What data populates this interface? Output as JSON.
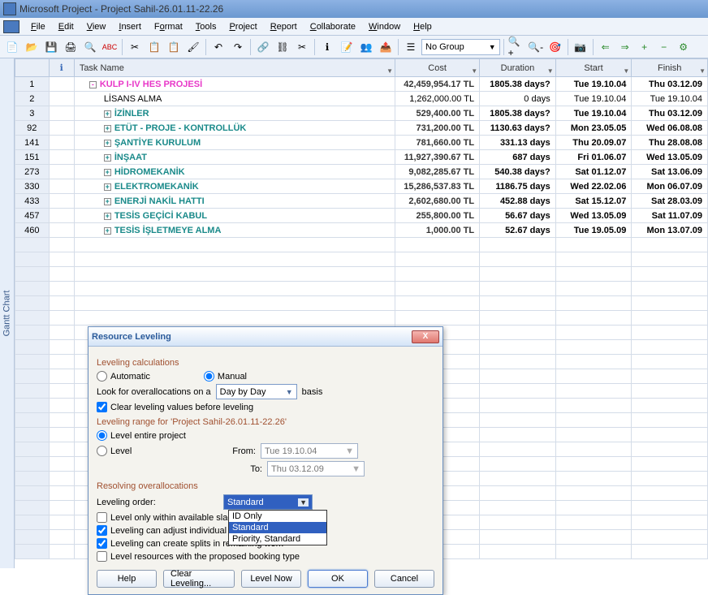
{
  "app_title": "Microsoft Project - Project Sahil-26.01.11-22.26",
  "menu": {
    "file": "File",
    "edit": "Edit",
    "view": "View",
    "insert": "Insert",
    "format": "Format",
    "tools": "Tools",
    "project": "Project",
    "report": "Report",
    "collaborate": "Collaborate",
    "window": "Window",
    "help": "Help"
  },
  "toolbar": {
    "group_label": "No Group"
  },
  "side_label": "Gantt Chart",
  "grid": {
    "headers": {
      "info": "ℹ",
      "task": "Task Name",
      "cost": "Cost",
      "duration": "Duration",
      "start": "Start",
      "finish": "Finish"
    },
    "rows": [
      {
        "n": "1",
        "task": "KULP I-IV HES PROJESİ",
        "cost": "42,459,954.17 TL",
        "dur": "1805.38 days?",
        "start": "Tue 19.10.04",
        "fin": "Thu 03.12.09",
        "cls": "proj",
        "exp": "-",
        "ind": 1
      },
      {
        "n": "2",
        "task": "LİSANS ALMA",
        "cost": "1,262,000.00 TL",
        "dur": "0 days",
        "start": "Tue 19.10.04",
        "fin": "Tue 19.10.04",
        "cls": "",
        "exp": "",
        "ind": 2
      },
      {
        "n": "3",
        "task": "İZİNLER",
        "cost": "529,400.00 TL",
        "dur": "1805.38 days?",
        "start": "Tue 19.10.04",
        "fin": "Thu 03.12.09",
        "cls": "subhead",
        "exp": "+",
        "ind": 2
      },
      {
        "n": "92",
        "task": "ETÜT - PROJE - KONTROLLÜK",
        "cost": "731,200.00 TL",
        "dur": "1130.63 days?",
        "start": "Mon 23.05.05",
        "fin": "Wed 06.08.08",
        "cls": "subhead",
        "exp": "+",
        "ind": 2
      },
      {
        "n": "141",
        "task": "ŞANTİYE KURULUM",
        "cost": "781,660.00 TL",
        "dur": "331.13 days",
        "start": "Thu 20.09.07",
        "fin": "Thu 28.08.08",
        "cls": "subhead",
        "exp": "+",
        "ind": 2
      },
      {
        "n": "151",
        "task": "İNŞAAT",
        "cost": "11,927,390.67 TL",
        "dur": "687 days",
        "start": "Fri 01.06.07",
        "fin": "Wed 13.05.09",
        "cls": "subhead",
        "exp": "+",
        "ind": 2
      },
      {
        "n": "273",
        "task": "HİDROMEKANİK",
        "cost": "9,082,285.67 TL",
        "dur": "540.38 days?",
        "start": "Sat 01.12.07",
        "fin": "Sat 13.06.09",
        "cls": "subhead",
        "exp": "+",
        "ind": 2
      },
      {
        "n": "330",
        "task": "ELEKTROMEKANİK",
        "cost": "15,286,537.83 TL",
        "dur": "1186.75 days",
        "start": "Wed 22.02.06",
        "fin": "Mon 06.07.09",
        "cls": "subhead",
        "exp": "+",
        "ind": 2
      },
      {
        "n": "433",
        "task": "ENERJİ NAKİL HATTI",
        "cost": "2,602,680.00 TL",
        "dur": "452.88 days",
        "start": "Sat 15.12.07",
        "fin": "Sat 28.03.09",
        "cls": "subhead",
        "exp": "+",
        "ind": 2
      },
      {
        "n": "457",
        "task": "TESİS GEÇİCİ KABUL",
        "cost": "255,800.00 TL",
        "dur": "56.67 days",
        "start": "Wed 13.05.09",
        "fin": "Sat 11.07.09",
        "cls": "subhead",
        "exp": "+",
        "ind": 2
      },
      {
        "n": "460",
        "task": "TESİS İŞLETMEYE ALMA",
        "cost": "1,000.00 TL",
        "dur": "52.67 days",
        "start": "Tue 19.05.09",
        "fin": "Mon 13.07.09",
        "cls": "subhead",
        "exp": "+",
        "ind": 2
      }
    ]
  },
  "dialog": {
    "title": "Resource Leveling",
    "sec_calc": "Leveling calculations",
    "automatic": "Automatic",
    "manual": "Manual",
    "look_for": "Look for overallocations on a",
    "basis": "basis",
    "period": "Day by Day",
    "clear_values": "Clear leveling values before leveling",
    "sec_range": "Leveling range for 'Project Sahil-26.01.11-22.26'",
    "level_entire": "Level entire project",
    "level": "Level",
    "from": "From:",
    "to": "To:",
    "from_val": "Tue 19.10.04",
    "to_val": "Thu 03.12.09",
    "sec_resolve": "Resolving overallocations",
    "order_label": "Leveling order:",
    "order_value": "Standard",
    "opt_slack": "Level only within available slack",
    "opt_adjust": "Leveling can adjust individual assignments on a task",
    "opt_splits": "Leveling can create splits in remaining work",
    "opt_booking": "Level resources with the proposed booking type",
    "btn_help": "Help",
    "btn_clear": "Clear Leveling...",
    "btn_now": "Level Now",
    "btn_ok": "OK",
    "btn_cancel": "Cancel",
    "dd": {
      "o1": "ID Only",
      "o2": "Standard",
      "o3": "Priority, Standard"
    }
  }
}
